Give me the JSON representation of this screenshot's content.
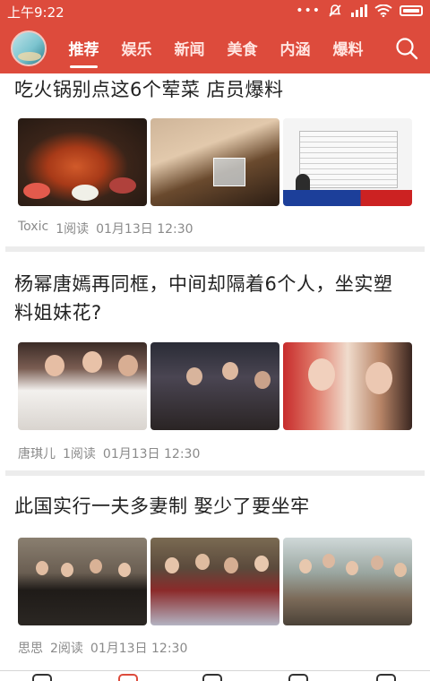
{
  "status_bar": {
    "time": "上午9:22",
    "icons": [
      "more-dots-icon",
      "notifications-off-icon",
      "signal-hd-icon",
      "wifi-icon",
      "battery-icon"
    ]
  },
  "header": {
    "avatar": "user-avatar",
    "tabs": [
      {
        "label": "推荐",
        "active": true
      },
      {
        "label": "娱乐",
        "active": false
      },
      {
        "label": "新闻",
        "active": false
      },
      {
        "label": "美食",
        "active": false
      },
      {
        "label": "内涵",
        "active": false
      },
      {
        "label": "爆料",
        "active": false
      }
    ],
    "search_icon": "search-icon"
  },
  "articles": [
    {
      "title": "吃火锅别点这6个荤菜 店员爆料",
      "images": [
        "hotpot-photo",
        "hands-photo",
        "tv-news-screenshot"
      ],
      "author": "Toxic",
      "reads": "1阅读",
      "time": "01月13日 12:30"
    },
    {
      "title": "杨幂唐嫣再同框，中间却隔着6个人，坐实塑料姐妹花?",
      "images": [
        "wedding-photo",
        "event-photo",
        "sisters-photo"
      ],
      "author": "唐琪儿",
      "reads": "1阅读",
      "time": "01月13日 12:30"
    },
    {
      "title": "此国实行一夫多妻制 娶少了要坐牢",
      "images": [
        "family-sofa-photo",
        "family-group-photo",
        "family-collage-photo"
      ],
      "author": "思思",
      "reads": "2阅读",
      "time": "01月13日 12:30"
    }
  ],
  "colors": {
    "brand": "#dd4b3c",
    "meta_text": "#8a8a8a",
    "divider": "#ececec"
  }
}
